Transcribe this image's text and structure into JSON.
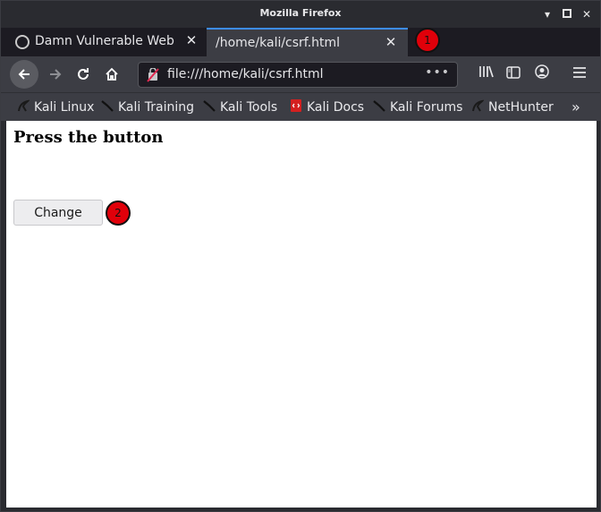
{
  "window": {
    "title": "Mozilla Firefox"
  },
  "tabs": [
    {
      "label": "Damn Vulnerable Web App",
      "active": false
    },
    {
      "label": "/home/kali/csrf.html",
      "active": true
    }
  ],
  "annotations": {
    "badge1": "1",
    "badge2": "2"
  },
  "url": {
    "value": "file:///home/kali/csrf.html",
    "more_label": "•••"
  },
  "bookmarks": [
    {
      "label": "Kali Linux"
    },
    {
      "label": "Kali Training"
    },
    {
      "label": "Kali Tools"
    },
    {
      "label": "Kali Docs"
    },
    {
      "label": "Kali Forums"
    },
    {
      "label": "NetHunter"
    }
  ],
  "page": {
    "heading": "Press the button",
    "button_label": "Change"
  },
  "colors": {
    "accent": "#3c8cf0",
    "badge": "#e0000a",
    "toolbar": "#3c3d44",
    "tabbar": "#1c1b22"
  }
}
